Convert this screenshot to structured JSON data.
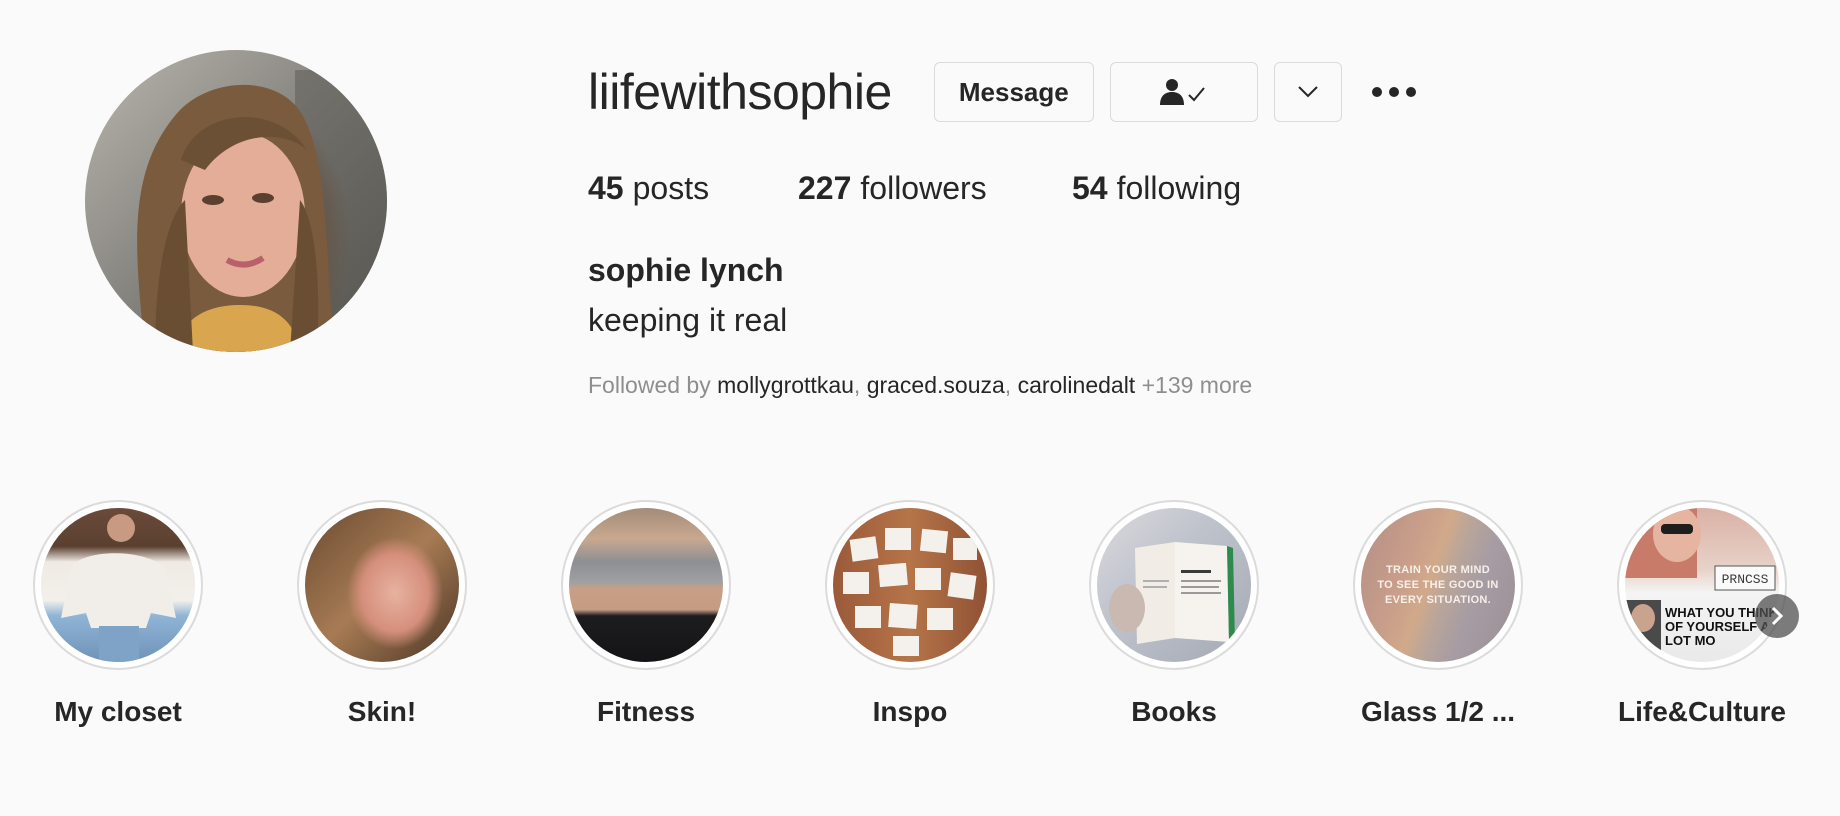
{
  "profile": {
    "username": "liifewithsophie",
    "full_name": "sophie lynch",
    "bio": "keeping it real",
    "avatar_icon": "profile-photo"
  },
  "actions": {
    "message_label": "Message",
    "following_icon": "person-check-icon",
    "dropdown_icon": "chevron-down-icon",
    "more_icon": "more-options-icon"
  },
  "stats": {
    "posts_count": "45",
    "posts_label": "posts",
    "followers_count": "227",
    "followers_label": "followers",
    "following_count": "54",
    "following_label": "following"
  },
  "followed_by": {
    "prefix": "Followed by",
    "users": [
      "mollygrottkau",
      "graced.souza",
      "carolinedalt"
    ],
    "more": "+139 more"
  },
  "highlights": [
    {
      "label": "My closet"
    },
    {
      "label": "Skin!"
    },
    {
      "label": "Fitness"
    },
    {
      "label": "Inspo"
    },
    {
      "label": "Books"
    },
    {
      "label": "Glass 1/2 ...",
      "image_text": "TRAIN YOUR MIND TO SEE THE GOOD IN EVERY SITUATION."
    },
    {
      "label": "Life&Culture",
      "image_text": [
        "PRNCSS",
        "WHAT YOU THINK OF YOURSELF A LOT MO"
      ]
    }
  ],
  "highlights_next_icon": "chevron-right-icon",
  "colors": {
    "background": "#fafafa",
    "text_primary": "#262626",
    "text_secondary": "#8e8e8e",
    "border": "#dbdbdb"
  }
}
